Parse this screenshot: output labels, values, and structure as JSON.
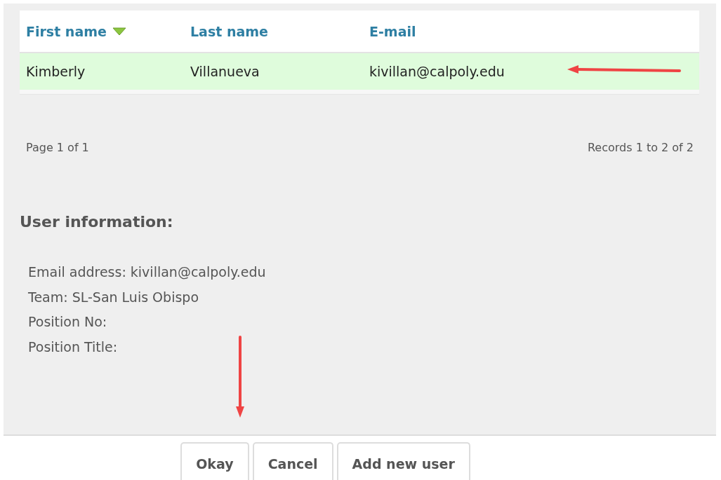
{
  "table": {
    "columns": [
      {
        "label": "First name",
        "sorted": true
      },
      {
        "label": "Last name",
        "sorted": false
      },
      {
        "label": "E-mail",
        "sorted": false
      }
    ],
    "rows": [
      {
        "cells": [
          "Kimberly",
          "Villanueva",
          "kivillan@calpoly.edu"
        ],
        "selected": true
      }
    ]
  },
  "pager": {
    "page": "Page 1 of 1",
    "records": "Records 1 to 2 of 2"
  },
  "user_info": {
    "heading": "User information:",
    "lines": [
      "Email address: kivillan@calpoly.edu",
      "Team: SL-San Luis Obispo",
      "Position No:",
      "Position Title:"
    ]
  },
  "buttons": [
    "Okay",
    "Cancel",
    "Add new user"
  ]
}
